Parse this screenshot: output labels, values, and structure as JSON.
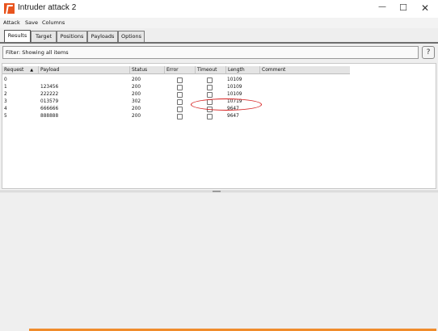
{
  "window": {
    "title": "Intruder attack 2",
    "controls": {
      "minimize": "—",
      "maximize": "☐",
      "close": "✕"
    },
    "accent": "#f08c2c"
  },
  "menu": {
    "items": [
      "Attack",
      "Save",
      "Columns"
    ]
  },
  "tabs": [
    "Results",
    "Target",
    "Positions",
    "Payloads",
    "Options"
  ],
  "active_tab": "Results",
  "filter": {
    "text": "Filter: Showing all items",
    "help": "?"
  },
  "table": {
    "columns": [
      "Request",
      "Payload",
      "Status",
      "Error",
      "Timeout",
      "Length",
      "Comment"
    ],
    "sort_indicator": "▲",
    "rows": [
      {
        "request": "0",
        "payload": "",
        "status": "200",
        "error": false,
        "timeout": false,
        "length": "10109",
        "comment": ""
      },
      {
        "request": "1",
        "payload": "123456",
        "status": "200",
        "error": false,
        "timeout": false,
        "length": "10109",
        "comment": ""
      },
      {
        "request": "2",
        "payload": "222222",
        "status": "200",
        "error": false,
        "timeout": false,
        "length": "10109",
        "comment": ""
      },
      {
        "request": "3",
        "payload": "013579",
        "status": "302",
        "error": false,
        "timeout": false,
        "length": "10719",
        "comment": ""
      },
      {
        "request": "4",
        "payload": "666666",
        "status": "200",
        "error": false,
        "timeout": false,
        "length": "9647",
        "comment": ""
      },
      {
        "request": "5",
        "payload": "888888",
        "status": "200",
        "error": false,
        "timeout": false,
        "length": "9647",
        "comment": ""
      }
    ]
  },
  "annotation": {
    "color": "#d61f1f",
    "highlighted_row": "3"
  }
}
